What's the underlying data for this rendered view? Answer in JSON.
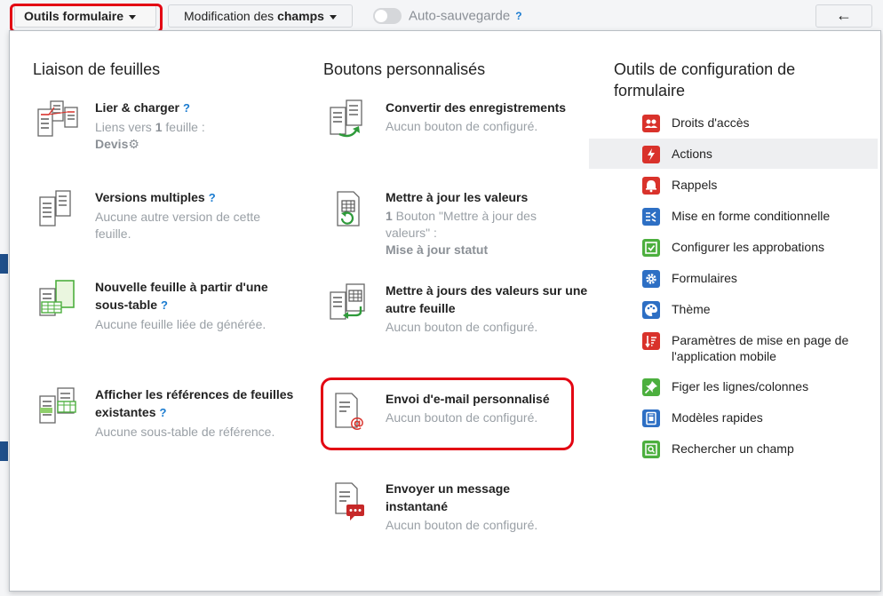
{
  "toolbar": {
    "form_tools_label": "Outils formulaire",
    "fields_label_prefix": "Modification des ",
    "fields_label_bold": "champs",
    "autosave_label": "Auto-sauvegarde",
    "help": "?",
    "back_arrow": "←"
  },
  "columns": {
    "left_title": "Liaison de feuilles",
    "middle_title": "Boutons personnalisés",
    "right_title": "Outils de configuration de formulaire"
  },
  "left_items": [
    {
      "title": "Lier & charger",
      "help": "?",
      "sub_prefix": "Liens vers ",
      "sub_bold": "1",
      "sub_suffix": " feuille :",
      "sub2": "Devis",
      "icon": "link-sheets-icon"
    },
    {
      "title": "Versions multiples",
      "help": "?",
      "sub": "Aucune autre version de cette feuille.",
      "icon": "multiple-versions-icon"
    },
    {
      "title": "Nouvelle feuille à partir d'une sous-table",
      "help": "?",
      "sub": "Aucune feuille liée de générée.",
      "icon": "new-sheet-from-subtable-icon"
    },
    {
      "title": "Afficher les références de feuilles existantes",
      "help": "?",
      "sub": "Aucune sous-table de référence.",
      "icon": "show-references-icon"
    }
  ],
  "middle_items": [
    {
      "title": "Convertir des enregistrements",
      "sub": "Aucun bouton de configuré.",
      "icon": "convert-records-icon"
    },
    {
      "title": "Mettre à jour les valeurs",
      "sub_bold": "1",
      "sub": " Bouton \"Mettre à jour des valeurs\" :",
      "sub2": "Mise à jour statut",
      "icon": "update-values-icon"
    },
    {
      "title": "Mettre à jours des valeurs sur une autre feuille",
      "sub": "Aucun bouton de configuré.",
      "icon": "update-other-sheet-icon"
    },
    {
      "title": "Envoi d'e-mail personnalisé",
      "sub": "Aucun bouton de configuré.",
      "icon": "email-icon"
    },
    {
      "title": "Envoyer un message instantané",
      "sub": "Aucun bouton de configuré.",
      "icon": "instant-message-icon"
    }
  ],
  "config_items": [
    {
      "label": "Droits d'accès",
      "icon": "access-rights-icon",
      "color": "#d9322b"
    },
    {
      "label": "Actions",
      "icon": "lightning-icon",
      "color": "#d9322b"
    },
    {
      "label": "Rappels",
      "icon": "bell-icon",
      "color": "#d9322b"
    },
    {
      "label": "Mise en forme conditionnelle",
      "icon": "conditional-format-icon",
      "color": "#2d6fc4"
    },
    {
      "label": "Configurer les approbations",
      "icon": "approvals-icon",
      "color": "#4caf3e"
    },
    {
      "label": "Formulaires",
      "icon": "gear-icon",
      "color": "#2d6fc4"
    },
    {
      "label": "Thème",
      "icon": "palette-icon",
      "color": "#2d6fc4"
    },
    {
      "label": "Paramètres de mise en page de l'application mobile",
      "icon": "mobile-layout-icon",
      "color": "#d9322b"
    },
    {
      "label": "Figer les lignes/colonnes",
      "icon": "pin-icon",
      "color": "#4caf3e"
    },
    {
      "label": "Modèles rapides",
      "icon": "templates-icon",
      "color": "#2d6fc4"
    },
    {
      "label": "Rechercher un champ",
      "icon": "search-field-icon",
      "color": "#4caf3e"
    }
  ]
}
